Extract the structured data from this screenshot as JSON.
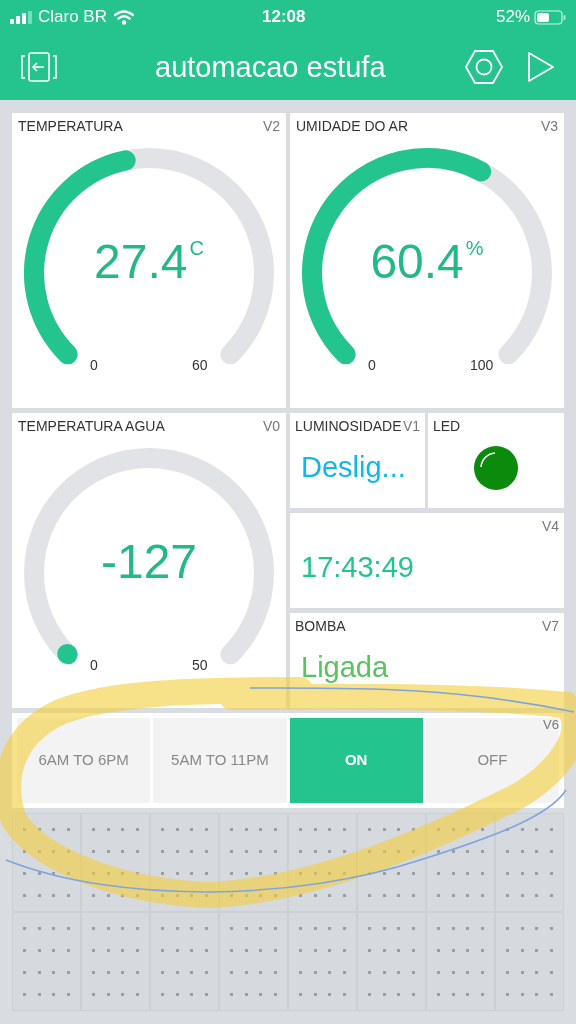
{
  "status_bar": {
    "carrier": "Claro BR",
    "time": "12:08",
    "battery": "52%"
  },
  "header": {
    "title": "automacao estufa"
  },
  "gauges": [
    {
      "label": "TEMPERATURA",
      "pin": "V2",
      "value": "27.4",
      "unit": "C",
      "min": "0",
      "max": "60"
    },
    {
      "label": "UMIDADE DO AR",
      "pin": "V3",
      "value": "60.4",
      "unit": "%",
      "min": "0",
      "max": "100"
    },
    {
      "label": "TEMPERATURA AGUA",
      "pin": "V0",
      "value": "-127",
      "min": "0",
      "max": "50"
    }
  ],
  "value_displays": [
    {
      "label": "LUMINOSIDADE",
      "pin": "V1",
      "value": "Deslig...",
      "color": "#10b8e8"
    },
    {
      "pin": "V4",
      "value": "17:43:49",
      "color": "#23c48e"
    },
    {
      "label": "BOMBA",
      "pin": "V7",
      "value": "Ligada",
      "color": "#5cc060"
    }
  ],
  "led": {
    "label": "LED",
    "on": true,
    "color": "#0b8a0b"
  },
  "segmented_switch": {
    "pin": "V6",
    "options": [
      {
        "label": "6AM TO 6PM",
        "selected": false
      },
      {
        "label": "5AM TO 11PM",
        "selected": false
      },
      {
        "label": "ON",
        "selected": true
      },
      {
        "label": "OFF",
        "selected": false
      }
    ]
  },
  "annotation": {
    "kind": "highlighter"
  }
}
